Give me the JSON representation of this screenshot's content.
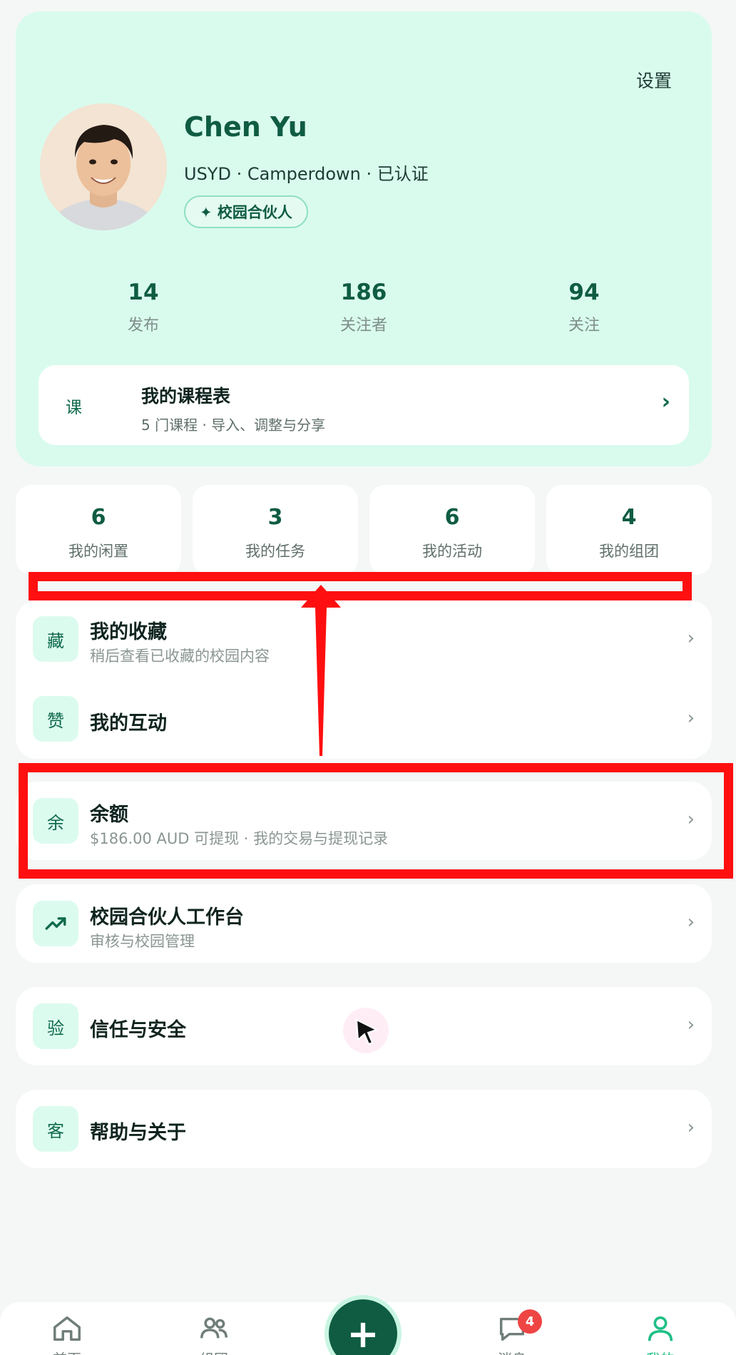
{
  "profile": {
    "settings_label": "设置",
    "name": "Chen Yu",
    "meta": "USYD · Camperdown · 已认证",
    "badge": "✦ 校园合伙人",
    "stats": [
      {
        "value": "14",
        "label": "发布"
      },
      {
        "value": "186",
        "label": "关注者"
      },
      {
        "value": "94",
        "label": "关注"
      }
    ],
    "schedule": {
      "icon": "课",
      "title": "我的课程表",
      "subtitle": "5 门课程 · 导入、调整与分享",
      "chevron": "›"
    }
  },
  "quick_stats": [
    {
      "value": "6",
      "label": "我的闲置"
    },
    {
      "value": "3",
      "label": "我的任务"
    },
    {
      "value": "6",
      "label": "我的活动"
    },
    {
      "value": "4",
      "label": "我的组团"
    }
  ],
  "menu": {
    "favorites": {
      "icon": "藏",
      "title": "我的收藏",
      "subtitle": "稍后查看已收藏的校园内容"
    },
    "interactions": {
      "icon": "赞",
      "title": "我的互动"
    },
    "balance": {
      "icon": "余",
      "title": "余额",
      "subtitle": "$186.00 AUD 可提现 · 我的交易与提现记录"
    },
    "partner": {
      "icon": "trending-up-icon",
      "title": "校园合伙人工作台",
      "subtitle": "审核与校园管理"
    },
    "trust": {
      "icon": "验",
      "title": "信任与安全"
    },
    "help": {
      "icon": "客",
      "title": "帮助与关于"
    },
    "chevron": "›"
  },
  "bottom_nav": {
    "items": [
      {
        "label": "首页",
        "icon": "home-icon"
      },
      {
        "label": "组团",
        "icon": "group-icon"
      },
      {
        "label": "消息",
        "icon": "chat-icon",
        "badge": "4"
      },
      {
        "label": "我的",
        "icon": "user-icon",
        "active": true
      }
    ],
    "fab": "+"
  },
  "colors": {
    "brand": "#0f5c43",
    "accent": "#1fbf86",
    "card_bg": "#d9fbee",
    "annotation": "#ff0f0f"
  }
}
